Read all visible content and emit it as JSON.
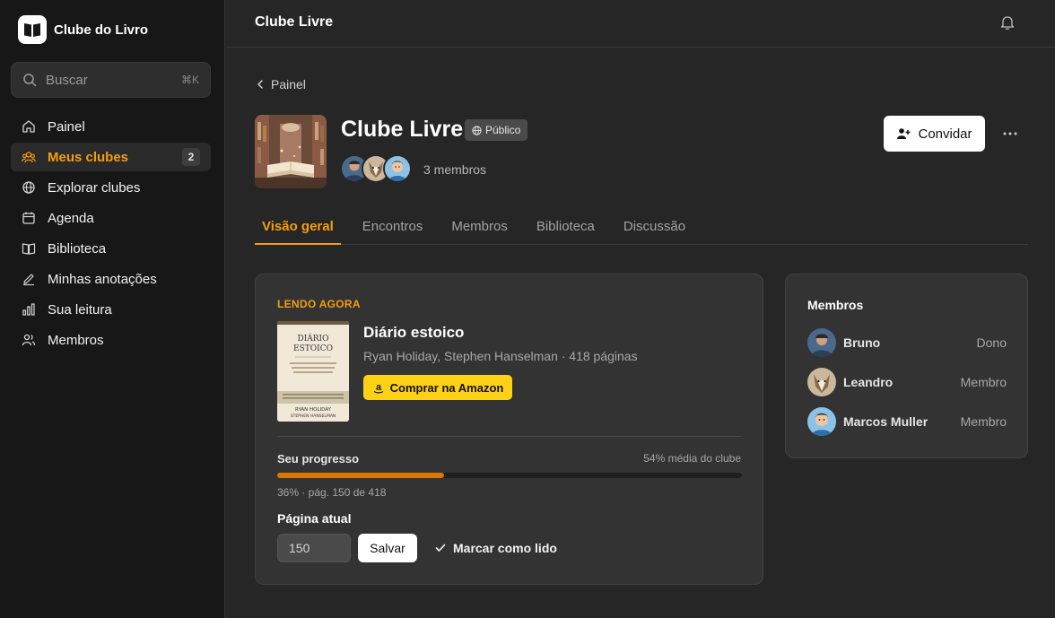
{
  "app": {
    "name": "Clube do Livro"
  },
  "search": {
    "placeholder": "Buscar",
    "shortcut": "⌘K"
  },
  "sidebar": {
    "items": [
      {
        "label": "Painel",
        "icon": "home-icon"
      },
      {
        "label": "Meus clubes",
        "icon": "users-icon",
        "badge": "2",
        "active": true
      },
      {
        "label": "Explorar clubes",
        "icon": "globe-icon"
      },
      {
        "label": "Agenda",
        "icon": "calendar-icon"
      },
      {
        "label": "Biblioteca",
        "icon": "book-open-icon"
      },
      {
        "label": "Minhas anotações",
        "icon": "pencil-icon"
      },
      {
        "label": "Sua leitura",
        "icon": "bar-chart-icon"
      },
      {
        "label": "Membros",
        "icon": "people-icon"
      }
    ]
  },
  "topbar": {
    "title": "Clube Livre"
  },
  "header": {
    "back_label": "Painel",
    "club_name": "Clube Livre",
    "visibility": "Público",
    "member_count": "3 membros",
    "invite_label": "Convidar"
  },
  "tabs": [
    {
      "label": "Visão geral",
      "active": true
    },
    {
      "label": "Encontros"
    },
    {
      "label": "Membros"
    },
    {
      "label": "Biblioteca"
    },
    {
      "label": "Discussão"
    }
  ],
  "reading": {
    "label": "LENDO AGORA",
    "book": {
      "title": "Diário estoico",
      "meta": "Ryan Holiday, Stephen Hanselman · 418 páginas",
      "cover_title_1": "DIÁRIO",
      "cover_title_2": "ESTOICO",
      "cover_authors_1": "RYAN HOLIDAY",
      "cover_authors_2": "STEPHEN HANSELMAN"
    },
    "amazon_label": "Comprar na Amazon",
    "progress_label": "Seu progresso",
    "club_average": "54% média do clube",
    "progress_percent": 36,
    "progress_detail": "36% · pág. 150 de 418",
    "page_label": "Página atual",
    "page_value": "150",
    "save_label": "Salvar",
    "mark_read_label": "Marcar como lido"
  },
  "members": {
    "title": "Membros",
    "list": [
      {
        "name": "Bruno",
        "role": "Dono"
      },
      {
        "name": "Leandro",
        "role": "Membro"
      },
      {
        "name": "Marcos Muller",
        "role": "Membro"
      }
    ]
  },
  "colors": {
    "accent": "#f59e0b",
    "progress": "#d97706",
    "amazon": "#fcd116"
  }
}
